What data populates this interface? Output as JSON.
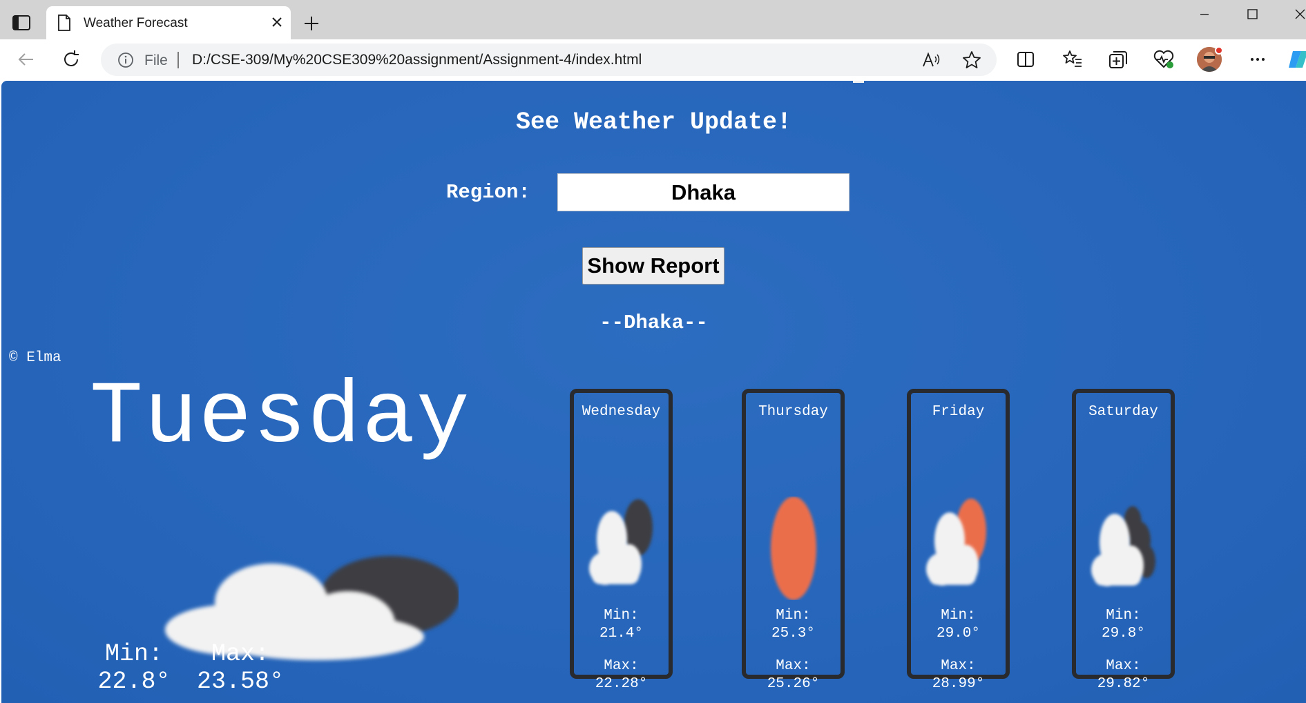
{
  "browser": {
    "tab_title": "Weather Forecast",
    "address": {
      "scheme_label": "File",
      "url": "D:/CSE-309/My%20CSE309%20assignment/Assignment-4/index.html"
    }
  },
  "page": {
    "heading": "See Weather Update!",
    "region_label": "Region:",
    "region_value": "Dhaka",
    "show_button": "Show Report",
    "city_heading": "--Dhaka--",
    "credit": "© Elma",
    "today": {
      "day": "Tuesday",
      "min_label": "Min:",
      "min_value": "22.8°",
      "max_label": "Max:",
      "max_value": "23.58°",
      "icon": "partly-cloudy-night-icon"
    },
    "forecast": [
      {
        "day": "Wednesday",
        "min_label": "Min:",
        "min_value": "21.4°",
        "max_label": "Max:",
        "max_value": "22.28°",
        "icon": "partly-cloudy-night-icon"
      },
      {
        "day": "Thursday",
        "min_label": "Min:",
        "min_value": "25.3°",
        "max_label": "Max:",
        "max_value": "25.26°",
        "icon": "sun-icon"
      },
      {
        "day": "Friday",
        "min_label": "Min:",
        "min_value": "29.0°",
        "max_label": "Max:",
        "max_value": "28.99°",
        "icon": "partly-cloudy-day-icon"
      },
      {
        "day": "Saturday",
        "min_label": "Min:",
        "min_value": "29.8°",
        "max_label": "Max:",
        "max_value": "29.82°",
        "icon": "cloudy-icon"
      }
    ]
  },
  "colors": {
    "page_background": "#2766bb",
    "card_border": "#282a2e",
    "sun": "#eb6e4b",
    "cloud": "#f2f2f2",
    "dark_cloud": "#3d3e42"
  }
}
